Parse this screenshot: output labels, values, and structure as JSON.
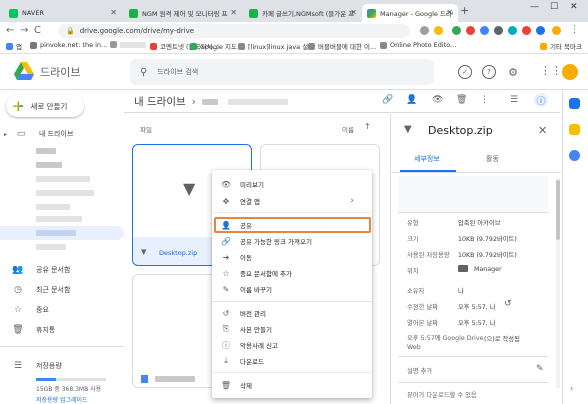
{
  "browser": {
    "tabs": [
      {
        "title": "NAVER",
        "color": "#03c75a"
      },
      {
        "title": "NGM 원격 제어 및 모니터링 프",
        "color": "#1bb24b"
      },
      {
        "title": "카페 글쓰기,NGMsoft (블가운 프",
        "color": "#1bb24b"
      },
      {
        "title": "Manager - Google 드라이브",
        "color": "#4285f4"
      }
    ],
    "new_tab": "+",
    "window_controls": {
      "minimize": "—",
      "maximize": "☐",
      "close": "✕"
    },
    "nav": {
      "back": "←",
      "forward": "→",
      "reload": "C",
      "home": "⌂"
    },
    "address": "drive.google.com/drive/my-drive",
    "bookmarks": [
      {
        "label": "앱",
        "color": "#4285f4"
      },
      {
        "label": "pinvoke.net: the in...",
        "color": "#777777"
      },
      {
        "label": "",
        "color": "#999999"
      },
      {
        "label": "코멘트넷 (한국지식...",
        "color": "#e94235"
      },
      {
        "label": "Google 지도",
        "color": "#34a853"
      },
      {
        "label": "[linux]linux java 설...",
        "color": "#888888"
      },
      {
        "label": "버블버블에 대한 이...",
        "color": "#888888"
      },
      {
        "label": "Online Photo Edito...",
        "color": "#888888"
      },
      {
        "label": "기타 북마크",
        "color": "#f9ab00"
      }
    ]
  },
  "drive": {
    "app_name": "드라이브",
    "search_placeholder": "드라이브 검색",
    "avatar_initial": "",
    "new_button": "새로 만들기",
    "sidebar": {
      "my_drive": "내 드라이브",
      "shared": "공유 문서함",
      "recent": "최근 문서함",
      "starred": "중요",
      "trash": "휴지통",
      "storage": "저장용량",
      "storage_used": "15GB 중 368.3MB 사용",
      "upgrade": "저장용량 업그레이드"
    },
    "breadcrumb": {
      "root": "내 드라이브",
      "sep": "›"
    },
    "list": {
      "section_label": "파일",
      "sort_label": "이름",
      "sort_arrow": "↑",
      "selected_file": "Desktop.zip"
    },
    "context_menu": [
      {
        "icon": "👁",
        "label": "미리보기",
        "name": "preview"
      },
      {
        "icon": "✥",
        "label": "연결 앱",
        "name": "open-with",
        "arrow": "›"
      },
      {
        "icon": "👤",
        "label": "공유",
        "name": "share"
      },
      {
        "icon": "🔗",
        "label": "공유 가능한 링크 가져오기",
        "name": "get-link"
      },
      {
        "icon": "➜",
        "label": "이동",
        "name": "move"
      },
      {
        "icon": "☆",
        "label": "중요 문서함에 추가",
        "name": "add-starred"
      },
      {
        "icon": "✎",
        "label": "이름 바꾸기",
        "name": "rename"
      },
      {
        "icon": "↺",
        "label": "버전 관리",
        "name": "manage-versions"
      },
      {
        "icon": "⎘",
        "label": "사본 만들기",
        "name": "make-copy"
      },
      {
        "icon": "ⓘ",
        "label": "악용사례 신고",
        "name": "report-abuse"
      },
      {
        "icon": "⤓",
        "label": "다운로드",
        "name": "download"
      },
      {
        "icon": "🗑",
        "label": "삭제",
        "name": "delete"
      }
    ],
    "details": {
      "title": "Desktop.zip",
      "close": "✕",
      "tab_details": "세부정보",
      "tab_activity": "활동",
      "rows": [
        {
          "label": "유형",
          "value": "압축된 아카이브"
        },
        {
          "label": "크기",
          "value": "10KB (9,792바이트)"
        },
        {
          "label": "사용된 저장용량",
          "value": "10KB (9,792바이트)"
        },
        {
          "label": "위치",
          "value": "Manager"
        },
        {
          "label": "소유자",
          "value": "나"
        },
        {
          "label": "수정한 날짜",
          "value": "오후 5:57, 나"
        },
        {
          "label": "열어본 날짜",
          "value": "오후 5:57, 나"
        },
        {
          "label": "오후 5:57에 Google Drive Web",
          "value": "(으)로 작성됨"
        }
      ],
      "add_description": "설명 추가",
      "viewers_note": "뷰어가 다운로드할 수 있음"
    }
  }
}
